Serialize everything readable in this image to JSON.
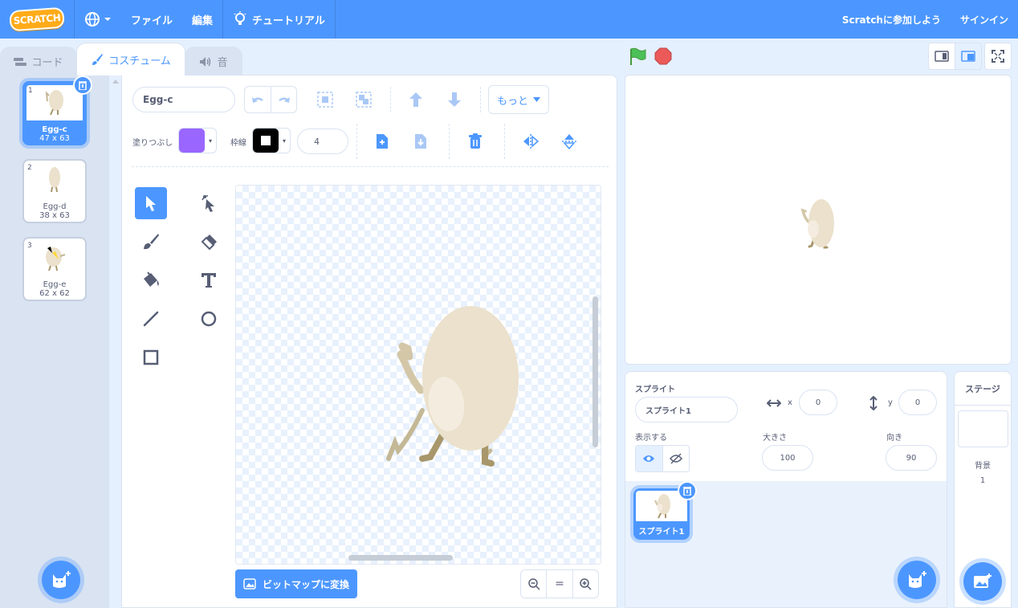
{
  "menubar": {
    "logo_text": "SCRATCH",
    "file": "ファイル",
    "edit": "編集",
    "tutorials": "チュートリアル",
    "join": "Scratchに参加しよう",
    "signin": "サインイン"
  },
  "tabs": {
    "code": "コード",
    "costumes": "コスチューム",
    "sounds": "音"
  },
  "costumes": [
    {
      "num": "1",
      "name": "Egg-c",
      "size": "47 x 63"
    },
    {
      "num": "2",
      "name": "Egg-d",
      "size": "38 x 63"
    },
    {
      "num": "3",
      "name": "Egg-e",
      "size": "62 x 62"
    }
  ],
  "editor": {
    "costume_name": "Egg-c",
    "more": "もっと",
    "fill_label": "塗りつぶし",
    "outline_label": "枠線",
    "outline_width": "4",
    "fill_color": "#9966ff",
    "outline_color": "#000000",
    "convert_bitmap": "ビットマップに変換",
    "zoom_reset": "="
  },
  "sprite": {
    "label": "スプライト",
    "name": "スプライト1",
    "x_label": "x",
    "x": "0",
    "y_label": "y",
    "y": "0",
    "show_label": "表示する",
    "size_label": "大きさ",
    "size": "100",
    "direction_label": "向き",
    "direction": "90"
  },
  "sprite_list": [
    {
      "name": "スプライト1"
    }
  ],
  "stage_panel": {
    "title": "ステージ",
    "backdrops_label": "背景",
    "backdrops_count": "1"
  },
  "colors": {
    "accent": "#4c97ff",
    "egg_body": "#ebe1cc",
    "egg_limb": "#c4b896"
  }
}
